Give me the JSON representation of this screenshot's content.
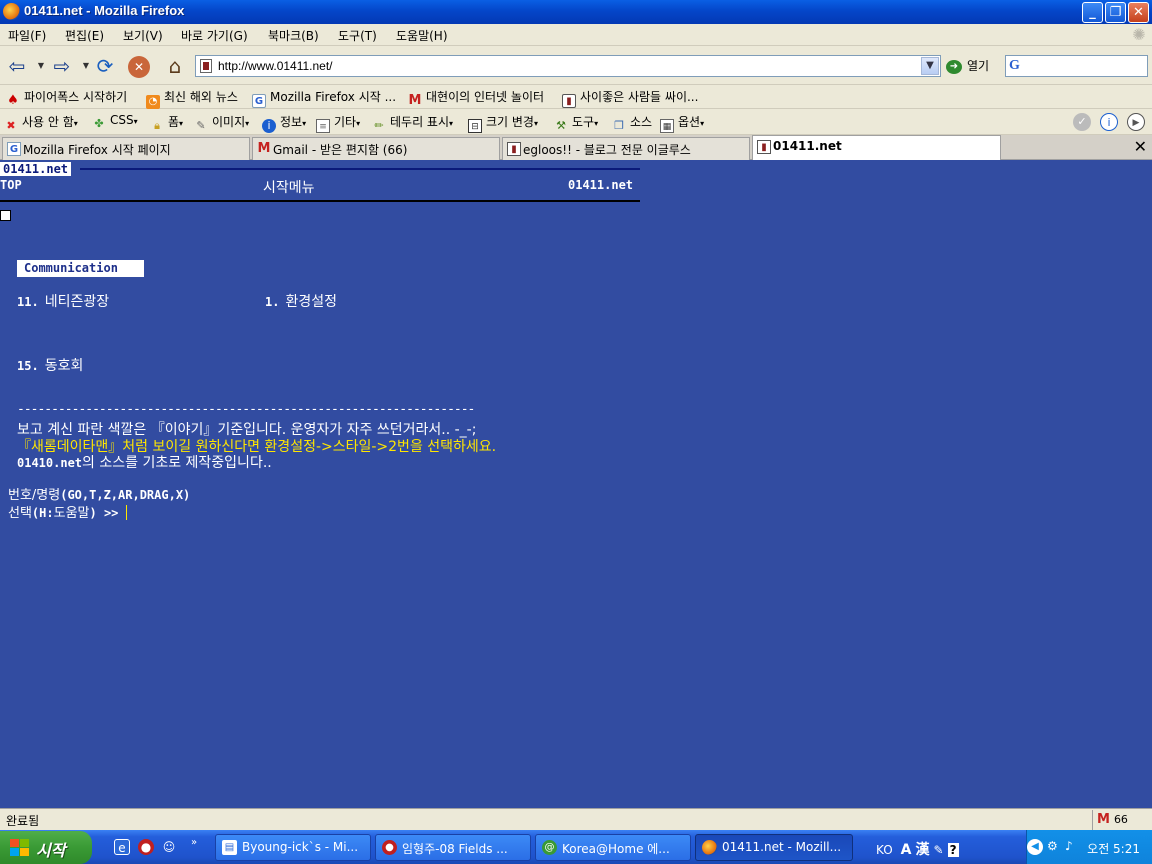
{
  "window": {
    "title": "01411.net - Mozilla Firefox",
    "minimize": "_",
    "maximize": "❐",
    "close": "✕"
  },
  "menu": [
    "파일(F)",
    "편집(E)",
    "보기(V)",
    "바로 가기(G)",
    "북마크(B)",
    "도구(T)",
    "도움말(H)"
  ],
  "nav": {
    "url": "http://www.01411.net/",
    "go_label": "열기",
    "search_placeholder": ""
  },
  "bookmarks": [
    "파이어폭스 시작하기",
    "최신 해외 뉴스",
    "Mozilla Firefox 시작 ...",
    "대현이의 인터넷 놀이터",
    "사이좋은 사람들 싸이..."
  ],
  "devtools": [
    "사용 안 함",
    "CSS",
    "폼",
    "이미지",
    "정보",
    "기타",
    "테두리 표시",
    "크기 변경",
    "도구",
    "소스",
    "옵션"
  ],
  "tabs": [
    {
      "label": "Mozilla Firefox 시작 페이지"
    },
    {
      "label": "Gmail - 받은 편지함 (66)"
    },
    {
      "label": "egloos!! - 블로그 전문 이글루스"
    },
    {
      "label": "01411.net"
    }
  ],
  "content": {
    "site_tag": "01411.net",
    "header_left": "TOP",
    "header_center": "시작메뉴",
    "header_right": "01411.net",
    "section_label": "Communication",
    "items": [
      {
        "num": "11.",
        "label": "네티즌광장"
      },
      {
        "num": "1.",
        "label": "환경설정"
      },
      {
        "num": "15.",
        "label": "동호회"
      }
    ],
    "divider": "-------------------------------------------------------------------",
    "notice_line1": "보고 계신 파란 색깔은 『이야기』기준입니다. 운영자가 자주 쓰던거라서.. -_-;",
    "notice_line2": "『새롬데이타맨』처럼 보이길 원하신다면 환경설정->스타일->2번을 선택하세요.",
    "notice_line3_prefix": "01410.net",
    "notice_line3_rest": "의 소스를 기초로 제작중입니다..",
    "cmd_label": "번호/명령",
    "cmd_options": "(GO,T,Z,AR,DRAG,X)",
    "prompt_label": "선택",
    "prompt_hint": "(H:",
    "prompt_help": "도움말",
    "prompt_end": ") >>"
  },
  "status": {
    "text": "완료됨",
    "gmail_count": "66"
  },
  "taskbar": {
    "start": "시작",
    "tasks": [
      "Byoung-ick`s - Mi...",
      "임형주-08 Fields ...",
      "Korea@Home 에...",
      "01411.net - Mozill..."
    ],
    "lang": "KO",
    "lang_a": "A",
    "lang_han": "漢",
    "clock": "오전 5:21"
  },
  "colors": {
    "page_bg": "#324ca1",
    "notice_yellow": "#ffe600",
    "title_blue": "#0446c9"
  }
}
